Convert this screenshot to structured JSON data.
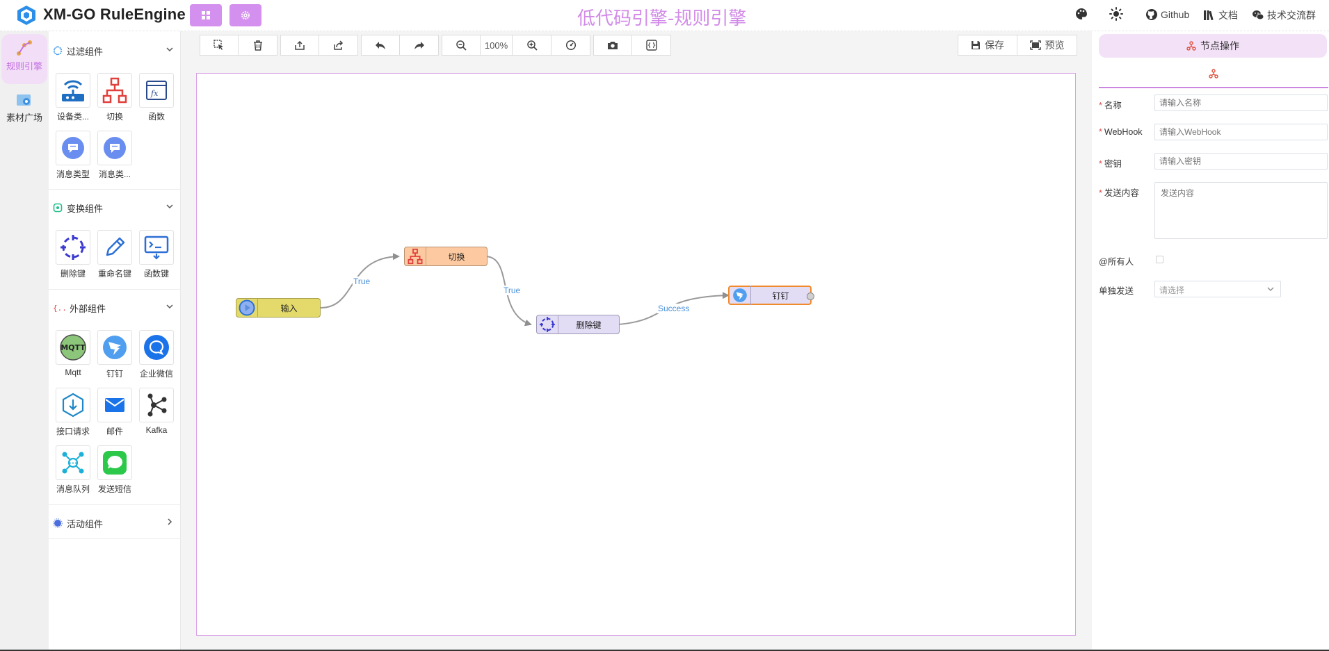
{
  "header": {
    "app_title": "XM-GO RuleEngine",
    "page_title": "低代码引擎-规则引擎",
    "links": [
      {
        "label": "Github",
        "icon": "github-icon"
      },
      {
        "label": "文档",
        "icon": "books-icon"
      },
      {
        "label": "技术交流群",
        "icon": "wechat-icon"
      }
    ],
    "accent": "#d490ee"
  },
  "leftnav": {
    "items": [
      {
        "label": "规则引擎",
        "icon": "rule-engine-icon",
        "active": true
      },
      {
        "label": "素材广场",
        "icon": "material-plaza-icon",
        "active": false
      }
    ]
  },
  "panel": {
    "sections": [
      {
        "title": "过滤组件",
        "expanded": true,
        "items": [
          {
            "label": "设备类...",
            "icon": "device-router-icon"
          },
          {
            "label": "切换",
            "icon": "switch-hierarchy-icon"
          },
          {
            "label": "函数",
            "icon": "function-icon"
          },
          {
            "label": "消息类型",
            "icon": "message-bubble-icon"
          },
          {
            "label": "消息类...",
            "icon": "message-bubble-icon"
          }
        ]
      },
      {
        "title": "变换组件",
        "expanded": true,
        "items": [
          {
            "label": "删除键",
            "icon": "delete-key-icon"
          },
          {
            "label": "重命名键",
            "icon": "rename-pen-icon"
          },
          {
            "label": "函数键",
            "icon": "function-key-icon"
          }
        ]
      },
      {
        "title": "外部组件",
        "expanded": true,
        "items": [
          {
            "label": "Mqtt",
            "icon": "mqtt-icon"
          },
          {
            "label": "钉钉",
            "icon": "dingtalk-icon"
          },
          {
            "label": "企业微信",
            "icon": "wecom-icon"
          },
          {
            "label": "接口请求",
            "icon": "api-request-icon"
          },
          {
            "label": "邮件",
            "icon": "mail-icon"
          },
          {
            "label": "Kafka",
            "icon": "kafka-icon"
          },
          {
            "label": "消息队列",
            "icon": "message-queue-icon"
          },
          {
            "label": "发送短信",
            "icon": "sms-icon"
          }
        ]
      },
      {
        "title": "活动组件",
        "expanded": false,
        "items": []
      }
    ]
  },
  "toolbar": {
    "zoom": "100%",
    "save_label": "保存",
    "preview_label": "预览"
  },
  "flow": {
    "nodes": [
      {
        "id": "input",
        "label": "输入"
      },
      {
        "id": "switch",
        "label": "切换"
      },
      {
        "id": "delete",
        "label": "删除键"
      },
      {
        "id": "dingtalk",
        "label": "钉钉"
      }
    ],
    "edges": [
      {
        "from": "input",
        "to": "switch",
        "label": "True"
      },
      {
        "from": "switch",
        "to": "delete",
        "label": "True"
      },
      {
        "from": "delete",
        "to": "dingtalk",
        "label": "Success"
      }
    ]
  },
  "rpanel": {
    "title": "节点操作",
    "fields": {
      "name": {
        "label": "名称",
        "placeholder": "请输入名称",
        "required": true
      },
      "webhook": {
        "label": "WebHook",
        "placeholder": "请输入WebHook",
        "required": true
      },
      "secret": {
        "label": "密钥",
        "placeholder": "请输入密钥",
        "required": true
      },
      "content": {
        "label": "发送内容",
        "placeholder": "发送内容",
        "required": true
      },
      "at_all": {
        "label": "@所有人",
        "checked": false
      },
      "single_send": {
        "label": "单独发送",
        "placeholder": "请选择"
      }
    }
  }
}
